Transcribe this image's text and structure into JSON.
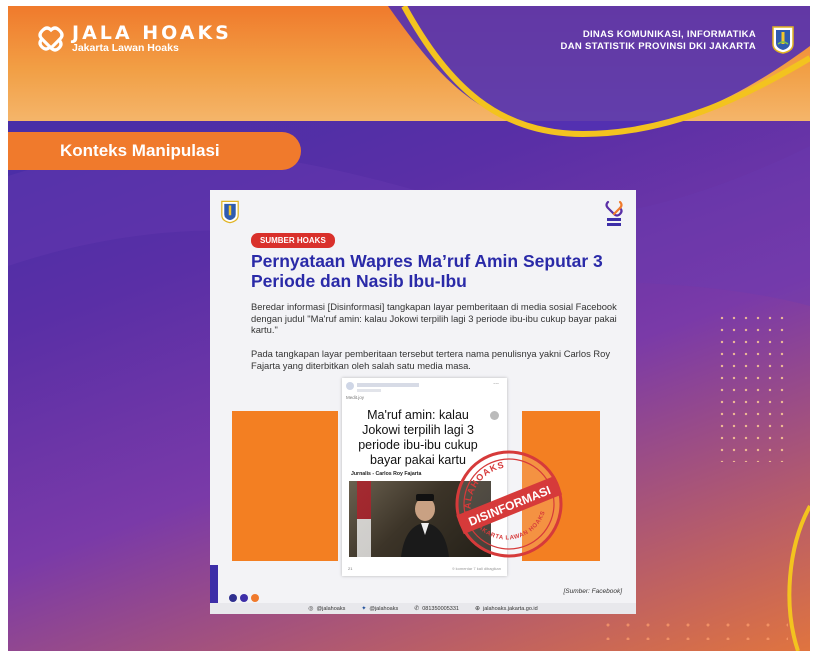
{
  "brand": {
    "title": "JALA HOAKS",
    "subtitle": "Jakarta Lawan Hoaks",
    "logo_icon": "chain-link-logo-icon"
  },
  "agency": {
    "line1": "DINAS KOMUNIKASI, INFORMATIKA",
    "line2": "DAN STATISTIK PROVINSI DKI JAKARTA",
    "crest_icon": "dki-crest-icon"
  },
  "section_label": "Konteks Manipulasi",
  "card": {
    "badge": "SUMBER HOAKS",
    "headline": "Pernyataan Wapres Ma’ruf Amin Seputar 3 Periode dan Nasib Ibu-Ibu",
    "paragraph1": "Beredar informasi [Disinformasi] tangkapan layar pemberitaan di media sosial Facebook dengan judul \"Ma'ruf amin: kalau Jokowi terpilih lagi 3 periode ibu-ibu cukup bayar pakai kartu.\"",
    "paragraph2": "Pada tangkapan layar pemberitaan tersebut tertera nama penulisnya yakni Carlos Roy Fajarta yang diterbitkan oleh salah satu media masa.",
    "post": {
      "menu": "...",
      "media_label": "Medit.joy",
      "quote": "Ma'ruf amin: kalau Jokowi terpilih lagi 3 periode ibu-ibu cukup bayar pakai kartu",
      "author": "Jurnalis - Carlos Roy Fajarta",
      "reactions": "21",
      "comments": "9 komentar  7 kali dibagikan"
    },
    "stamp": {
      "top_text": "JALAHOAKS",
      "main_text": "DISINFORMASI",
      "bottom_text": "JAKARTA LAWAN HOAKS"
    },
    "source": "[Sumber: Facebook]",
    "footer": {
      "instagram": "@jalahoaks",
      "twitter": "@jalahoaks",
      "whatsapp": "081350005331",
      "web": "jalahoaks.jakarta.go.id"
    }
  },
  "colors": {
    "orange": "#f07a2c",
    "purple": "#3d2ea8",
    "headline_blue": "#2a2aa8",
    "badge_red": "#d9302b",
    "stamp_red": "#d63a3a"
  }
}
